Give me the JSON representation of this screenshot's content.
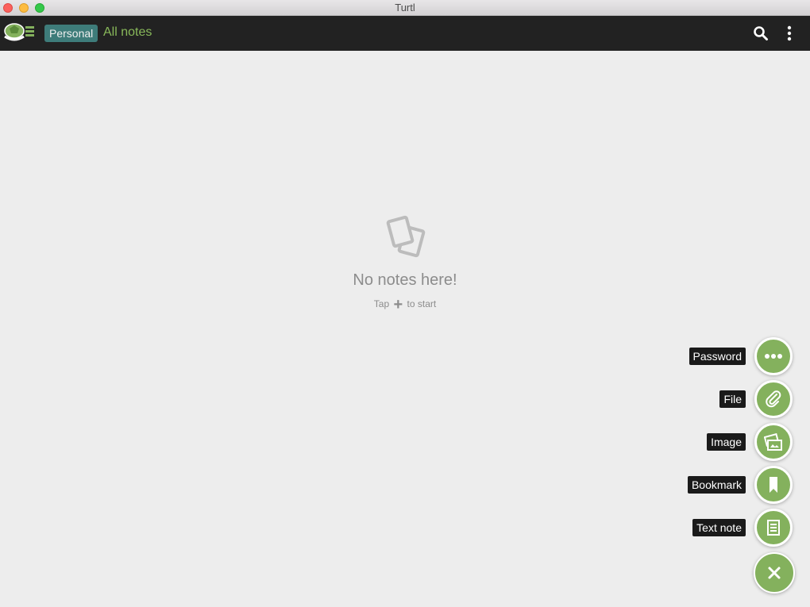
{
  "window": {
    "title": "Turtl"
  },
  "header": {
    "space_name": "Personal",
    "board_name": "All notes",
    "icons": {
      "logo": "turtle-logo-icon",
      "search": "search-icon",
      "menu": "more-vertical-icon"
    }
  },
  "empty_state": {
    "icon": "empty-notes-icon",
    "title": "No notes here!",
    "subtitle_before": "Tap",
    "subtitle_plus": "+",
    "subtitle_after": "to start"
  },
  "fab_menu": {
    "items": [
      {
        "label": "Password",
        "icon": "dots-icon"
      },
      {
        "label": "File",
        "icon": "paperclip-icon"
      },
      {
        "label": "Image",
        "icon": "image-icon"
      },
      {
        "label": "Bookmark",
        "icon": "bookmark-icon"
      },
      {
        "label": "Text note",
        "icon": "text-note-icon"
      }
    ],
    "close_icon": "close-icon"
  },
  "colors": {
    "accent": "#84b15d",
    "header_bg": "#222222",
    "space_badge": "#3e7c7a",
    "background": "#ededed"
  }
}
